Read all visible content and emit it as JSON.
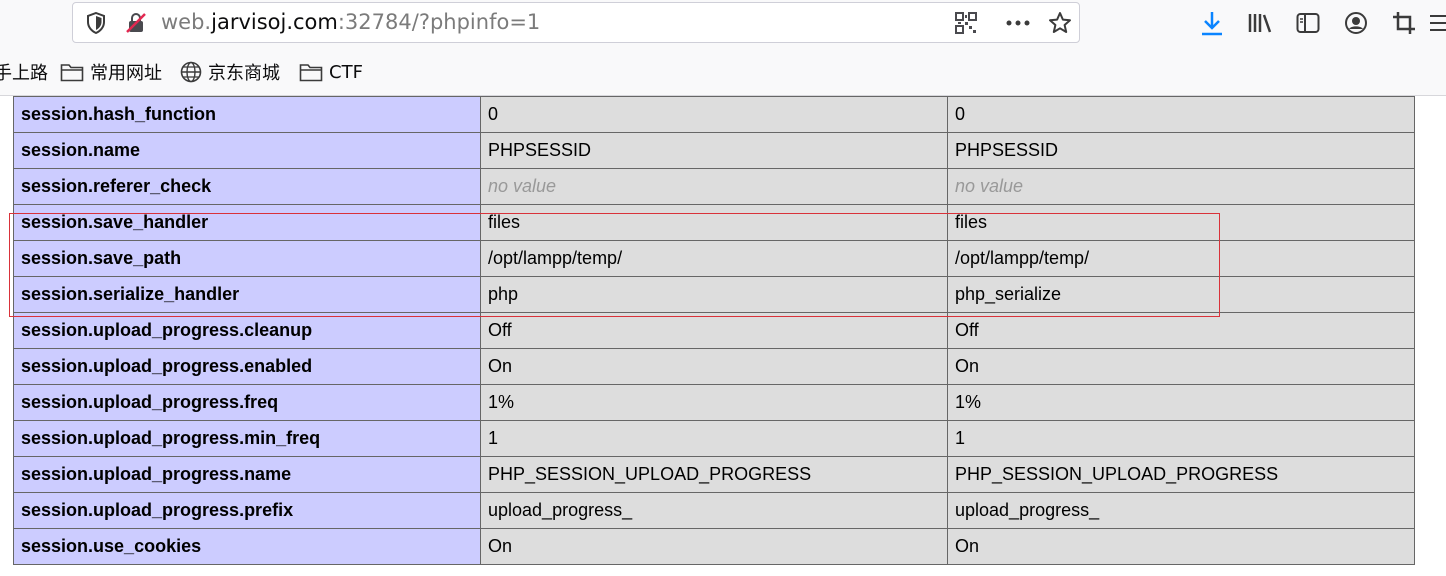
{
  "urlbar": {
    "url_prefix": "web.",
    "url_domain": "jarvisoj.com",
    "url_suffix": ":32784/?phpinfo=1"
  },
  "bookmarks": [
    {
      "label": "手上路",
      "icon": "none"
    },
    {
      "label": "常用网址",
      "icon": "folder-icon"
    },
    {
      "label": "京东商城",
      "icon": "globe-icon"
    },
    {
      "label": "CTF",
      "icon": "folder-icon"
    }
  ],
  "colors": {
    "directive_bg": "#ccccff",
    "value_bg": "#dddddd",
    "highlight_border": "#d9323a",
    "download_icon": "#0a84ff"
  },
  "table": {
    "rows": [
      {
        "directive": "session.hash_function",
        "local": "0",
        "master": "0"
      },
      {
        "directive": "session.name",
        "local": "PHPSESSID",
        "master": "PHPSESSID"
      },
      {
        "directive": "session.referer_check",
        "local": "no value",
        "master": "no value",
        "novalue": true
      },
      {
        "directive": "session.save_handler",
        "local": "files",
        "master": "files"
      },
      {
        "directive": "session.save_path",
        "local": "/opt/lampp/temp/",
        "master": "/opt/lampp/temp/"
      },
      {
        "directive": "session.serialize_handler",
        "local": "php",
        "master": "php_serialize"
      },
      {
        "directive": "session.upload_progress.cleanup",
        "local": "Off",
        "master": "Off"
      },
      {
        "directive": "session.upload_progress.enabled",
        "local": "On",
        "master": "On"
      },
      {
        "directive": "session.upload_progress.freq",
        "local": "1%",
        "master": "1%"
      },
      {
        "directive": "session.upload_progress.min_freq",
        "local": "1",
        "master": "1"
      },
      {
        "directive": "session.upload_progress.name",
        "local": "PHP_SESSION_UPLOAD_PROGRESS",
        "master": "PHP_SESSION_UPLOAD_PROGRESS"
      },
      {
        "directive": "session.upload_progress.prefix",
        "local": "upload_progress_",
        "master": "upload_progress_"
      },
      {
        "directive": "session.use_cookies",
        "local": "On",
        "master": "On"
      }
    ]
  }
}
